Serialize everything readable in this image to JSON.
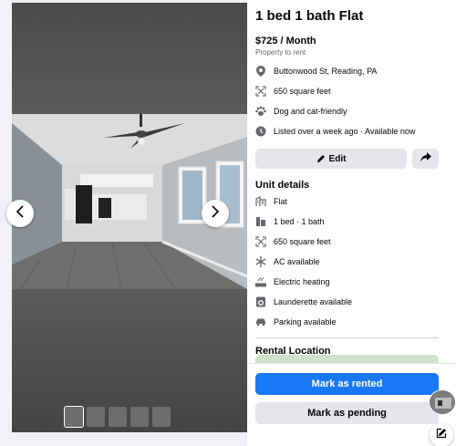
{
  "listing": {
    "title": "1 bed 1 bath Flat",
    "price": "$725 / Month",
    "subtitle": "Property to rent",
    "meta": [
      {
        "icon": "location-pin-icon",
        "text": "Buttonwood St, Reading, PA"
      },
      {
        "icon": "area-icon",
        "text": "650 square feet"
      },
      {
        "icon": "paw-icon",
        "text": "Dog and cat-friendly"
      },
      {
        "icon": "clock-icon",
        "text": "Listed over a week ago · Available now"
      }
    ]
  },
  "actions": {
    "edit_label": "Edit",
    "share_icon": "share-icon"
  },
  "unit_details": {
    "title": "Unit details",
    "items": [
      {
        "icon": "building-icon",
        "text": "Flat"
      },
      {
        "icon": "bed-bath-icon",
        "text": "1 bed · 1 bath"
      },
      {
        "icon": "area-icon",
        "text": "650 square feet"
      },
      {
        "icon": "snowflake-icon",
        "text": "AC available"
      },
      {
        "icon": "heating-icon",
        "text": "Electric heating"
      },
      {
        "icon": "washer-icon",
        "text": "Launderette available"
      },
      {
        "icon": "car-icon",
        "text": "Parking available"
      }
    ]
  },
  "location": {
    "title": "Rental Location"
  },
  "footer": {
    "mark_rented": "Mark as rented",
    "mark_pending": "Mark as pending"
  },
  "photos": {
    "thumbnail_count": 5,
    "active_index": 0
  },
  "colors": {
    "primary": "#1877f2",
    "secondary_bg": "#e4e6eb",
    "muted_text": "#65676b",
    "page_bg": "#f0f2f5"
  }
}
